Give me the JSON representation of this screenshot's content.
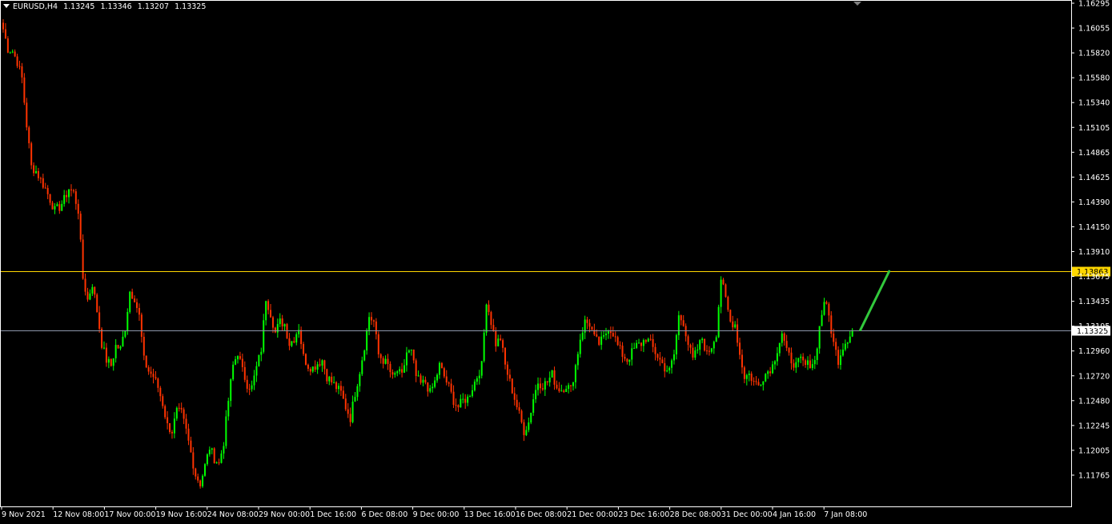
{
  "header": {
    "symbol": "EURUSD,H4",
    "open": "1.13245",
    "high": "1.13346",
    "low": "1.13207",
    "close": "1.13325"
  },
  "colors": {
    "background": "#000000",
    "frame": "#ffffff",
    "bull": "#00ff00",
    "bear": "#ff3300",
    "resistance_line": "#ffd700",
    "bid_line": "#8c96aa",
    "projection_arrow": "#32c83c"
  },
  "chart_data": {
    "type": "candlestick",
    "symbol": "EURUSD",
    "timeframe": "H4",
    "ylim": [
      1.1171,
      1.1634
    ],
    "y_ticks": [
      "1.16295",
      "1.16055",
      "1.15820",
      "1.15580",
      "1.15340",
      "1.15105",
      "1.14865",
      "1.14625",
      "1.14390",
      "1.14150",
      "1.13910",
      "1.13675",
      "1.13435",
      "1.13195",
      "1.12960",
      "1.12720",
      "1.12480",
      "1.12245",
      "1.12005",
      "1.11765"
    ],
    "x_ticks": [
      "9 Nov 2021",
      "12 Nov 08:00",
      "17 Nov 00:00",
      "19 Nov 16:00",
      "24 Nov 08:00",
      "29 Nov 00:00",
      "1 Dec 16:00",
      "6 Dec 08:00",
      "9 Dec 00:00",
      "13 Dec 16:00",
      "16 Dec 08:00",
      "21 Dec 00:00",
      "23 Dec 16:00",
      "28 Dec 08:00",
      "31 Dec 00:00",
      "4 Jan 16:00",
      "7 Jan 08:00"
    ],
    "horizontal_levels": [
      {
        "label": "1.13863",
        "value": 1.13863,
        "kind": "resistance"
      },
      {
        "label": "1.13325",
        "value": 1.13325,
        "kind": "bid"
      }
    ],
    "projection": {
      "from": 1.13325,
      "to": 1.13863
    },
    "path": [
      [
        0,
        1.1608
      ],
      [
        2,
        1.159
      ],
      [
        4,
        1.1588
      ],
      [
        6,
        1.1578
      ],
      [
        8,
        1.1563
      ],
      [
        10,
        1.152
      ],
      [
        12,
        1.1482
      ],
      [
        14,
        1.1478
      ],
      [
        16,
        1.147
      ],
      [
        18,
        1.1462
      ],
      [
        20,
        1.1452
      ],
      [
        22,
        1.1442
      ],
      [
        24,
        1.1445
      ],
      [
        26,
        1.1452
      ],
      [
        28,
        1.1462
      ],
      [
        30,
        1.1458
      ],
      [
        32,
        1.1442
      ],
      [
        34,
        1.138
      ],
      [
        36,
        1.136
      ],
      [
        38,
        1.1375
      ],
      [
        40,
        1.135
      ],
      [
        42,
        1.132
      ],
      [
        44,
        1.1305
      ],
      [
        46,
        1.13
      ],
      [
        48,
        1.1318
      ],
      [
        50,
        1.1315
      ],
      [
        52,
        1.1335
      ],
      [
        54,
        1.1368
      ],
      [
        56,
        1.1362
      ],
      [
        58,
        1.1345
      ],
      [
        60,
        1.1305
      ],
      [
        62,
        1.1295
      ],
      [
        64,
        1.129
      ],
      [
        66,
        1.128
      ],
      [
        68,
        1.1265
      ],
      [
        70,
        1.1245
      ],
      [
        72,
        1.124
      ],
      [
        74,
        1.1258
      ],
      [
        76,
        1.1256
      ],
      [
        78,
        1.124
      ],
      [
        80,
        1.122
      ],
      [
        82,
        1.12
      ],
      [
        84,
        1.1192
      ],
      [
        86,
        1.1208
      ],
      [
        88,
        1.1225
      ],
      [
        90,
        1.1215
      ],
      [
        92,
        1.121
      ],
      [
        94,
        1.123
      ],
      [
        96,
        1.1268
      ],
      [
        98,
        1.13
      ],
      [
        100,
        1.1312
      ],
      [
        102,
        1.1295
      ],
      [
        104,
        1.1283
      ],
      [
        106,
        1.128
      ],
      [
        108,
        1.1298
      ],
      [
        110,
        1.1315
      ],
      [
        112,
        1.1362
      ],
      [
        114,
        1.1348
      ],
      [
        116,
        1.133
      ],
      [
        118,
        1.134
      ],
      [
        120,
        1.1338
      ],
      [
        122,
        1.132
      ],
      [
        124,
        1.1325
      ],
      [
        126,
        1.1335
      ],
      [
        128,
        1.1308
      ],
      [
        130,
        1.13
      ],
      [
        132,
        1.1298
      ],
      [
        134,
        1.1302
      ],
      [
        136,
        1.1305
      ],
      [
        138,
        1.129
      ],
      [
        140,
        1.1285
      ],
      [
        142,
        1.128
      ],
      [
        144,
        1.1275
      ],
      [
        146,
        1.1262
      ],
      [
        148,
        1.1252
      ],
      [
        150,
        1.1275
      ],
      [
        152,
        1.1295
      ],
      [
        154,
        1.1318
      ],
      [
        156,
        1.1345
      ],
      [
        158,
        1.134
      ],
      [
        160,
        1.131
      ],
      [
        162,
        1.1305
      ],
      [
        164,
        1.13
      ],
      [
        166,
        1.1288
      ],
      [
        168,
        1.1295
      ],
      [
        170,
        1.129
      ],
      [
        172,
        1.1312
      ],
      [
        174,
        1.1312
      ],
      [
        176,
        1.129
      ],
      [
        178,
        1.1283
      ],
      [
        180,
        1.1285
      ],
      [
        182,
        1.1275
      ],
      [
        184,
        1.1285
      ],
      [
        186,
        1.13
      ],
      [
        188,
        1.129
      ],
      [
        190,
        1.128
      ],
      [
        192,
        1.1268
      ],
      [
        194,
        1.1262
      ],
      [
        196,
        1.1268
      ],
      [
        198,
        1.127
      ],
      [
        200,
        1.128
      ],
      [
        202,
        1.129
      ],
      [
        204,
        1.13
      ],
      [
        206,
        1.136
      ],
      [
        208,
        1.134
      ],
      [
        210,
        1.132
      ],
      [
        212,
        1.1325
      ],
      [
        214,
        1.13
      ],
      [
        216,
        1.1285
      ],
      [
        218,
        1.127
      ],
      [
        220,
        1.1255
      ],
      [
        222,
        1.124
      ],
      [
        224,
        1.1248
      ],
      [
        226,
        1.127
      ],
      [
        228,
        1.1285
      ],
      [
        230,
        1.1282
      ],
      [
        232,
        1.1285
      ],
      [
        234,
        1.1292
      ],
      [
        236,
        1.128
      ],
      [
        238,
        1.1278
      ],
      [
        240,
        1.1282
      ],
      [
        242,
        1.1278
      ],
      [
        244,
        1.13
      ],
      [
        246,
        1.1325
      ],
      [
        248,
        1.134
      ],
      [
        250,
        1.1338
      ],
      [
        252,
        1.1325
      ],
      [
        254,
        1.132
      ],
      [
        256,
        1.1325
      ],
      [
        258,
        1.1335
      ],
      [
        260,
        1.133
      ],
      [
        262,
        1.1318
      ],
      [
        264,
        1.131
      ],
      [
        266,
        1.1305
      ],
      [
        268,
        1.1312
      ],
      [
        270,
        1.1318
      ],
      [
        272,
        1.132
      ],
      [
        274,
        1.1325
      ],
      [
        276,
        1.132
      ],
      [
        278,
        1.1312
      ],
      [
        280,
        1.1305
      ],
      [
        282,
        1.1298
      ],
      [
        284,
        1.1295
      ],
      [
        286,
        1.131
      ],
      [
        288,
        1.1345
      ],
      [
        290,
        1.134
      ],
      [
        292,
        1.132
      ],
      [
        294,
        1.1305
      ],
      [
        296,
        1.1315
      ],
      [
        298,
        1.1325
      ],
      [
        300,
        1.131
      ],
      [
        302,
        1.1318
      ],
      [
        304,
        1.133
      ],
      [
        306,
        1.138
      ],
      [
        308,
        1.136
      ],
      [
        310,
        1.134
      ],
      [
        312,
        1.1338
      ],
      [
        314,
        1.131
      ],
      [
        316,
        1.129
      ],
      [
        318,
        1.1292
      ],
      [
        320,
        1.1285
      ],
      [
        322,
        1.1282
      ],
      [
        324,
        1.129
      ],
      [
        326,
        1.1295
      ],
      [
        328,
        1.13
      ],
      [
        330,
        1.1315
      ],
      [
        332,
        1.133
      ],
      [
        334,
        1.1312
      ],
      [
        336,
        1.1305
      ],
      [
        338,
        1.13
      ],
      [
        340,
        1.1305
      ],
      [
        342,
        1.13
      ],
      [
        344,
        1.1302
      ],
      [
        346,
        1.1304
      ],
      [
        348,
        1.1335
      ],
      [
        350,
        1.136
      ],
      [
        352,
        1.1345
      ],
      [
        354,
        1.132
      ],
      [
        356,
        1.1305
      ],
      [
        358,
        1.1318
      ],
      [
        360,
        1.1325
      ],
      [
        362,
        1.13325
      ]
    ]
  }
}
